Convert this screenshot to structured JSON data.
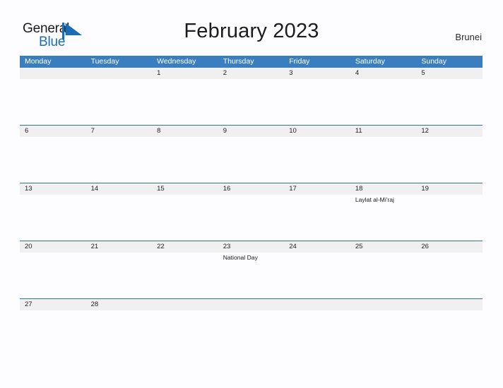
{
  "brand": {
    "name_part1": "General",
    "name_part2": "Blue",
    "triangle_icon": "triangle-logo-icon",
    "color_dark": "#1a1a1a",
    "color_blue": "#1b6cb5"
  },
  "header": {
    "title": "February 2023",
    "country": "Brunei"
  },
  "theme": {
    "header_blue": "#3a7ebf",
    "rule_blue": "#2f72ad",
    "band_gray": "#f0f0f0",
    "page_background": "#fdfdff"
  },
  "weekday_headers": [
    "Monday",
    "Tuesday",
    "Wednesday",
    "Thursday",
    "Friday",
    "Saturday",
    "Sunday"
  ],
  "weeks": [
    {
      "height": "tall",
      "days": [
        {
          "num": "",
          "events": []
        },
        {
          "num": "",
          "events": []
        },
        {
          "num": "1",
          "events": []
        },
        {
          "num": "2",
          "events": []
        },
        {
          "num": "3",
          "events": []
        },
        {
          "num": "4",
          "events": []
        },
        {
          "num": "5",
          "events": []
        }
      ]
    },
    {
      "height": "tall",
      "days": [
        {
          "num": "6",
          "events": []
        },
        {
          "num": "7",
          "events": []
        },
        {
          "num": "8",
          "events": []
        },
        {
          "num": "9",
          "events": []
        },
        {
          "num": "10",
          "events": []
        },
        {
          "num": "11",
          "events": []
        },
        {
          "num": "12",
          "events": []
        }
      ]
    },
    {
      "height": "tall",
      "days": [
        {
          "num": "13",
          "events": []
        },
        {
          "num": "14",
          "events": []
        },
        {
          "num": "15",
          "events": []
        },
        {
          "num": "16",
          "events": []
        },
        {
          "num": "17",
          "events": []
        },
        {
          "num": "18",
          "events": [
            "Laylat al-Mi'raj"
          ]
        },
        {
          "num": "19",
          "events": []
        }
      ]
    },
    {
      "height": "tall",
      "days": [
        {
          "num": "20",
          "events": []
        },
        {
          "num": "21",
          "events": []
        },
        {
          "num": "22",
          "events": []
        },
        {
          "num": "23",
          "events": [
            "National Day"
          ]
        },
        {
          "num": "24",
          "events": []
        },
        {
          "num": "25",
          "events": []
        },
        {
          "num": "26",
          "events": []
        }
      ]
    },
    {
      "height": "short",
      "days": [
        {
          "num": "27",
          "events": []
        },
        {
          "num": "28",
          "events": []
        },
        {
          "num": "",
          "events": []
        },
        {
          "num": "",
          "events": []
        },
        {
          "num": "",
          "events": []
        },
        {
          "num": "",
          "events": []
        },
        {
          "num": "",
          "events": []
        }
      ]
    }
  ]
}
